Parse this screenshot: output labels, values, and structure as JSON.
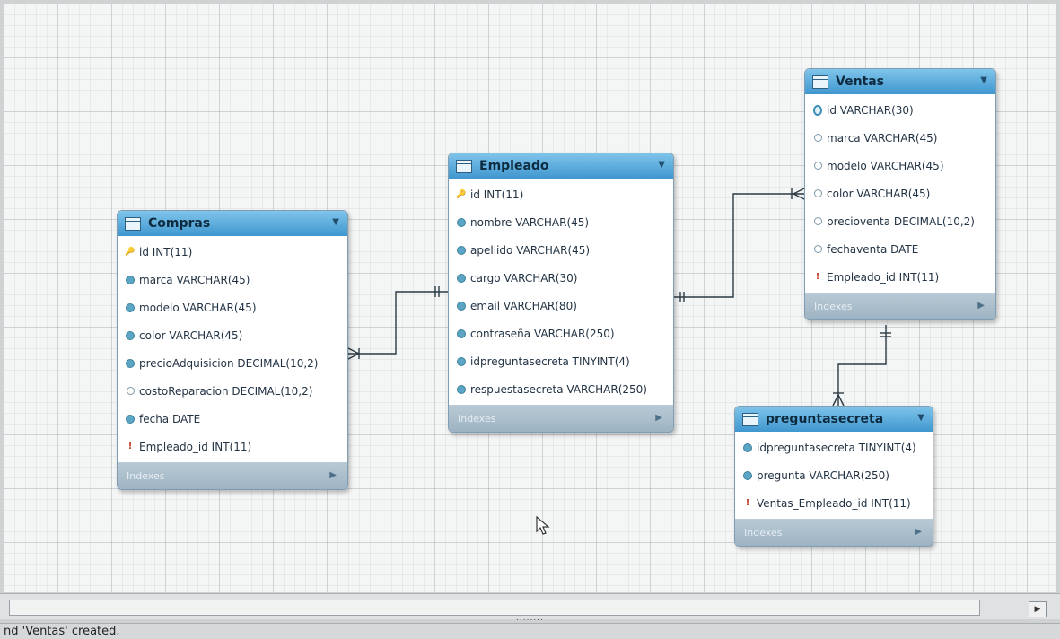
{
  "diagram": {
    "tables": [
      {
        "name": "Compras",
        "columns": [
          {
            "icon": "pk",
            "text": "id INT(11)"
          },
          {
            "icon": "col-filled",
            "text": "marca VARCHAR(45)"
          },
          {
            "icon": "col-filled",
            "text": "modelo VARCHAR(45)"
          },
          {
            "icon": "col-filled",
            "text": "color VARCHAR(45)"
          },
          {
            "icon": "col-filled",
            "text": "precioAdquisicion DECIMAL(10,2)"
          },
          {
            "icon": "col-hollow",
            "text": "costoReparacion DECIMAL(10,2)"
          },
          {
            "icon": "col-filled",
            "text": "fecha DATE"
          },
          {
            "icon": "fk",
            "text": "Empleado_id INT(11)"
          }
        ],
        "footer": "Indexes"
      },
      {
        "name": "Empleado",
        "columns": [
          {
            "icon": "pk",
            "text": "id INT(11)"
          },
          {
            "icon": "col-filled",
            "text": "nombre VARCHAR(45)"
          },
          {
            "icon": "col-filled",
            "text": "apellido VARCHAR(45)"
          },
          {
            "icon": "col-filled",
            "text": "cargo VARCHAR(30)"
          },
          {
            "icon": "col-filled",
            "text": "email VARCHAR(80)"
          },
          {
            "icon": "col-filled",
            "text": "contraseña VARCHAR(250)"
          },
          {
            "icon": "col-filled",
            "text": "idpreguntasecreta TINYINT(4)"
          },
          {
            "icon": "col-filled",
            "text": "respuestasecreta VARCHAR(250)"
          }
        ],
        "footer": "Indexes"
      },
      {
        "name": "Ventas",
        "columns": [
          {
            "icon": "pk-diamond",
            "text": "id VARCHAR(30)"
          },
          {
            "icon": "col-hollow",
            "text": "marca VARCHAR(45)"
          },
          {
            "icon": "col-hollow",
            "text": "modelo VARCHAR(45)"
          },
          {
            "icon": "col-hollow",
            "text": "color VARCHAR(45)"
          },
          {
            "icon": "col-hollow",
            "text": "precioventa DECIMAL(10,2)"
          },
          {
            "icon": "col-hollow",
            "text": "fechaventa DATE"
          },
          {
            "icon": "fk",
            "text": "Empleado_id INT(11)"
          }
        ],
        "footer": "Indexes"
      },
      {
        "name": "preguntasecreta",
        "columns": [
          {
            "icon": "col-filled",
            "text": "idpreguntasecreta TINYINT(4)"
          },
          {
            "icon": "col-filled",
            "text": "pregunta VARCHAR(250)"
          },
          {
            "icon": "fk",
            "text": "Ventas_Empleado_id INT(11)"
          }
        ],
        "footer": "Indexes"
      }
    ]
  },
  "scrollbar": {
    "grip": "........"
  },
  "status": {
    "message": "nd 'Ventas' created."
  }
}
